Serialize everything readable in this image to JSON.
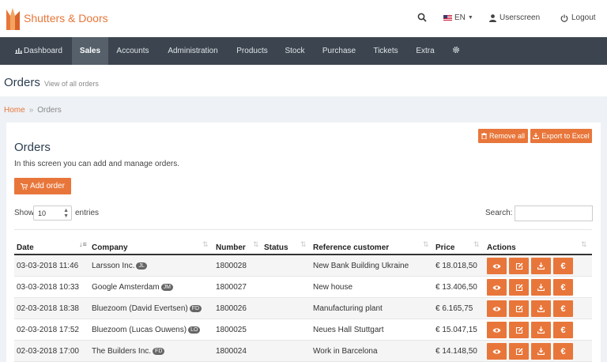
{
  "brand": {
    "name": "Shutters & Doors"
  },
  "topbar": {
    "language": "EN",
    "user": "Userscreen",
    "logout": "Logout"
  },
  "nav": {
    "items": [
      {
        "label": "Dashboard"
      },
      {
        "label": "Sales"
      },
      {
        "label": "Accounts"
      },
      {
        "label": "Administration"
      },
      {
        "label": "Products"
      },
      {
        "label": "Stock"
      },
      {
        "label": "Purchase"
      },
      {
        "label": "Tickets"
      },
      {
        "label": "Extra"
      }
    ],
    "active": "Sales"
  },
  "page": {
    "title": "Orders",
    "subtitle": "View of all orders"
  },
  "breadcrumb": {
    "home": "Home",
    "separator": "»",
    "current": "Orders"
  },
  "card": {
    "title": "Orders",
    "description": "In this screen you can add and manage orders.",
    "remove_all": "Remove all",
    "export": "Export to Excel",
    "add_order": "Add order"
  },
  "table_controls": {
    "show_label": "Show",
    "show_value": "10",
    "entries_label": "entries",
    "search_label": "Search:",
    "search_value": ""
  },
  "table": {
    "columns": [
      "Date",
      "Company",
      "Number",
      "Status",
      "Reference customer",
      "Price",
      "Actions"
    ],
    "rows": [
      {
        "date": "03-03-2018 11:46",
        "company": "Larsson Inc.",
        "initials": "JL",
        "number": "1800028",
        "status": "",
        "reference": "New Bank Building Ukraine",
        "price": "€ 18.018,50"
      },
      {
        "date": "03-03-2018 10:33",
        "company": "Google Amsterdam",
        "initials": "JM",
        "number": "1800027",
        "status": "",
        "reference": "New house",
        "price": "€ 13.406,50"
      },
      {
        "date": "02-03-2018 18:38",
        "company": "Bluezoom (David Evertsen)",
        "initials": "FD",
        "number": "1800026",
        "status": "",
        "reference": "Manufacturing plant",
        "price": "€ 6.165,75"
      },
      {
        "date": "02-03-2018 17:52",
        "company": "Bluezoom (Lucas Ouwens)",
        "initials": "LO",
        "number": "1800025",
        "status": "",
        "reference": "Neues Hall Stuttgart",
        "price": "€ 15.047,15"
      },
      {
        "date": "02-03-2018 17:00",
        "company": "The Builders Inc.",
        "initials": "FD",
        "number": "1800024",
        "status": "",
        "reference": "Work in Barcelona",
        "price": "€ 14.148,50"
      }
    ],
    "action_icons": [
      "eye-icon",
      "edit-icon",
      "download-icon",
      "euro-icon"
    ]
  },
  "colors": {
    "accent": "#e8763a",
    "navbar": "#3c454f",
    "nav_active": "#55606b"
  }
}
